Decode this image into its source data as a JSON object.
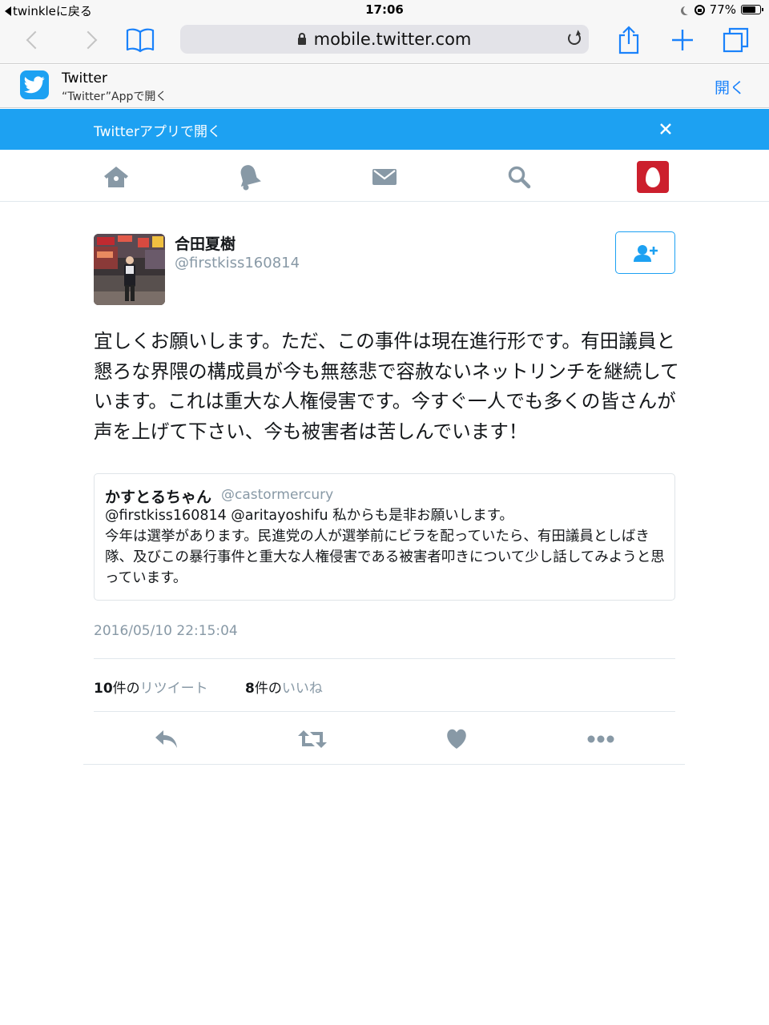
{
  "status_bar": {
    "back_label": "twinkleに戻る",
    "time": "17:06",
    "battery": "77%",
    "battery_level": 0.77
  },
  "browser": {
    "url": "mobile.twitter.com"
  },
  "app_banner": {
    "title": "Twitter",
    "subtitle": "“Twitter”Appで開く",
    "open_label": "開く"
  },
  "open_in_app_bar": {
    "text": "Twitterアプリで開く"
  },
  "tweet": {
    "author_name": "合田夏樹",
    "author_handle": "@firstkiss160814",
    "text": "宜しくお願いします。ただ、この事件は現在進行形です。有田議員と懇ろな界隈の構成員が今も無慈悲で容赦ないネットリンチを継続しています。これは重大な人権侵害です。今すぐ一人でも多くの皆さんが声を上げて下さい、今も被害者は苦しんでいます！",
    "quoted": {
      "author_name": "かすとるちゃん",
      "author_handle": "@castormercury",
      "text_line1": "@firstkiss160814 @aritayoshifu 私からも是非お願いします。",
      "text_rest": "今年は選挙があります。民進党の人が選挙前にビラを配っていたら、有田議員としばき隊、及びこの暴行事件と重大な人権侵害である被害者叩きについて少し話してみようと思っています。"
    },
    "timestamp": "2016/05/10 22:15:04",
    "retweets_count": "10",
    "retweets_suffix": "件の",
    "retweets_label": "リツイート",
    "likes_count": "8",
    "likes_suffix": "件の",
    "likes_label": "いいね"
  },
  "icons": {
    "nav": [
      "home-icon",
      "notifications-icon",
      "messages-icon",
      "search-icon",
      "profile-icon"
    ],
    "actions": [
      "reply-icon",
      "retweet-icon",
      "like-icon",
      "more-icon"
    ]
  },
  "colors": {
    "twitter_blue": "#1da1f2",
    "icon_gray": "#8899a6",
    "safari_blue": "#1a82fb",
    "profile_red": "#cc1f2d"
  }
}
